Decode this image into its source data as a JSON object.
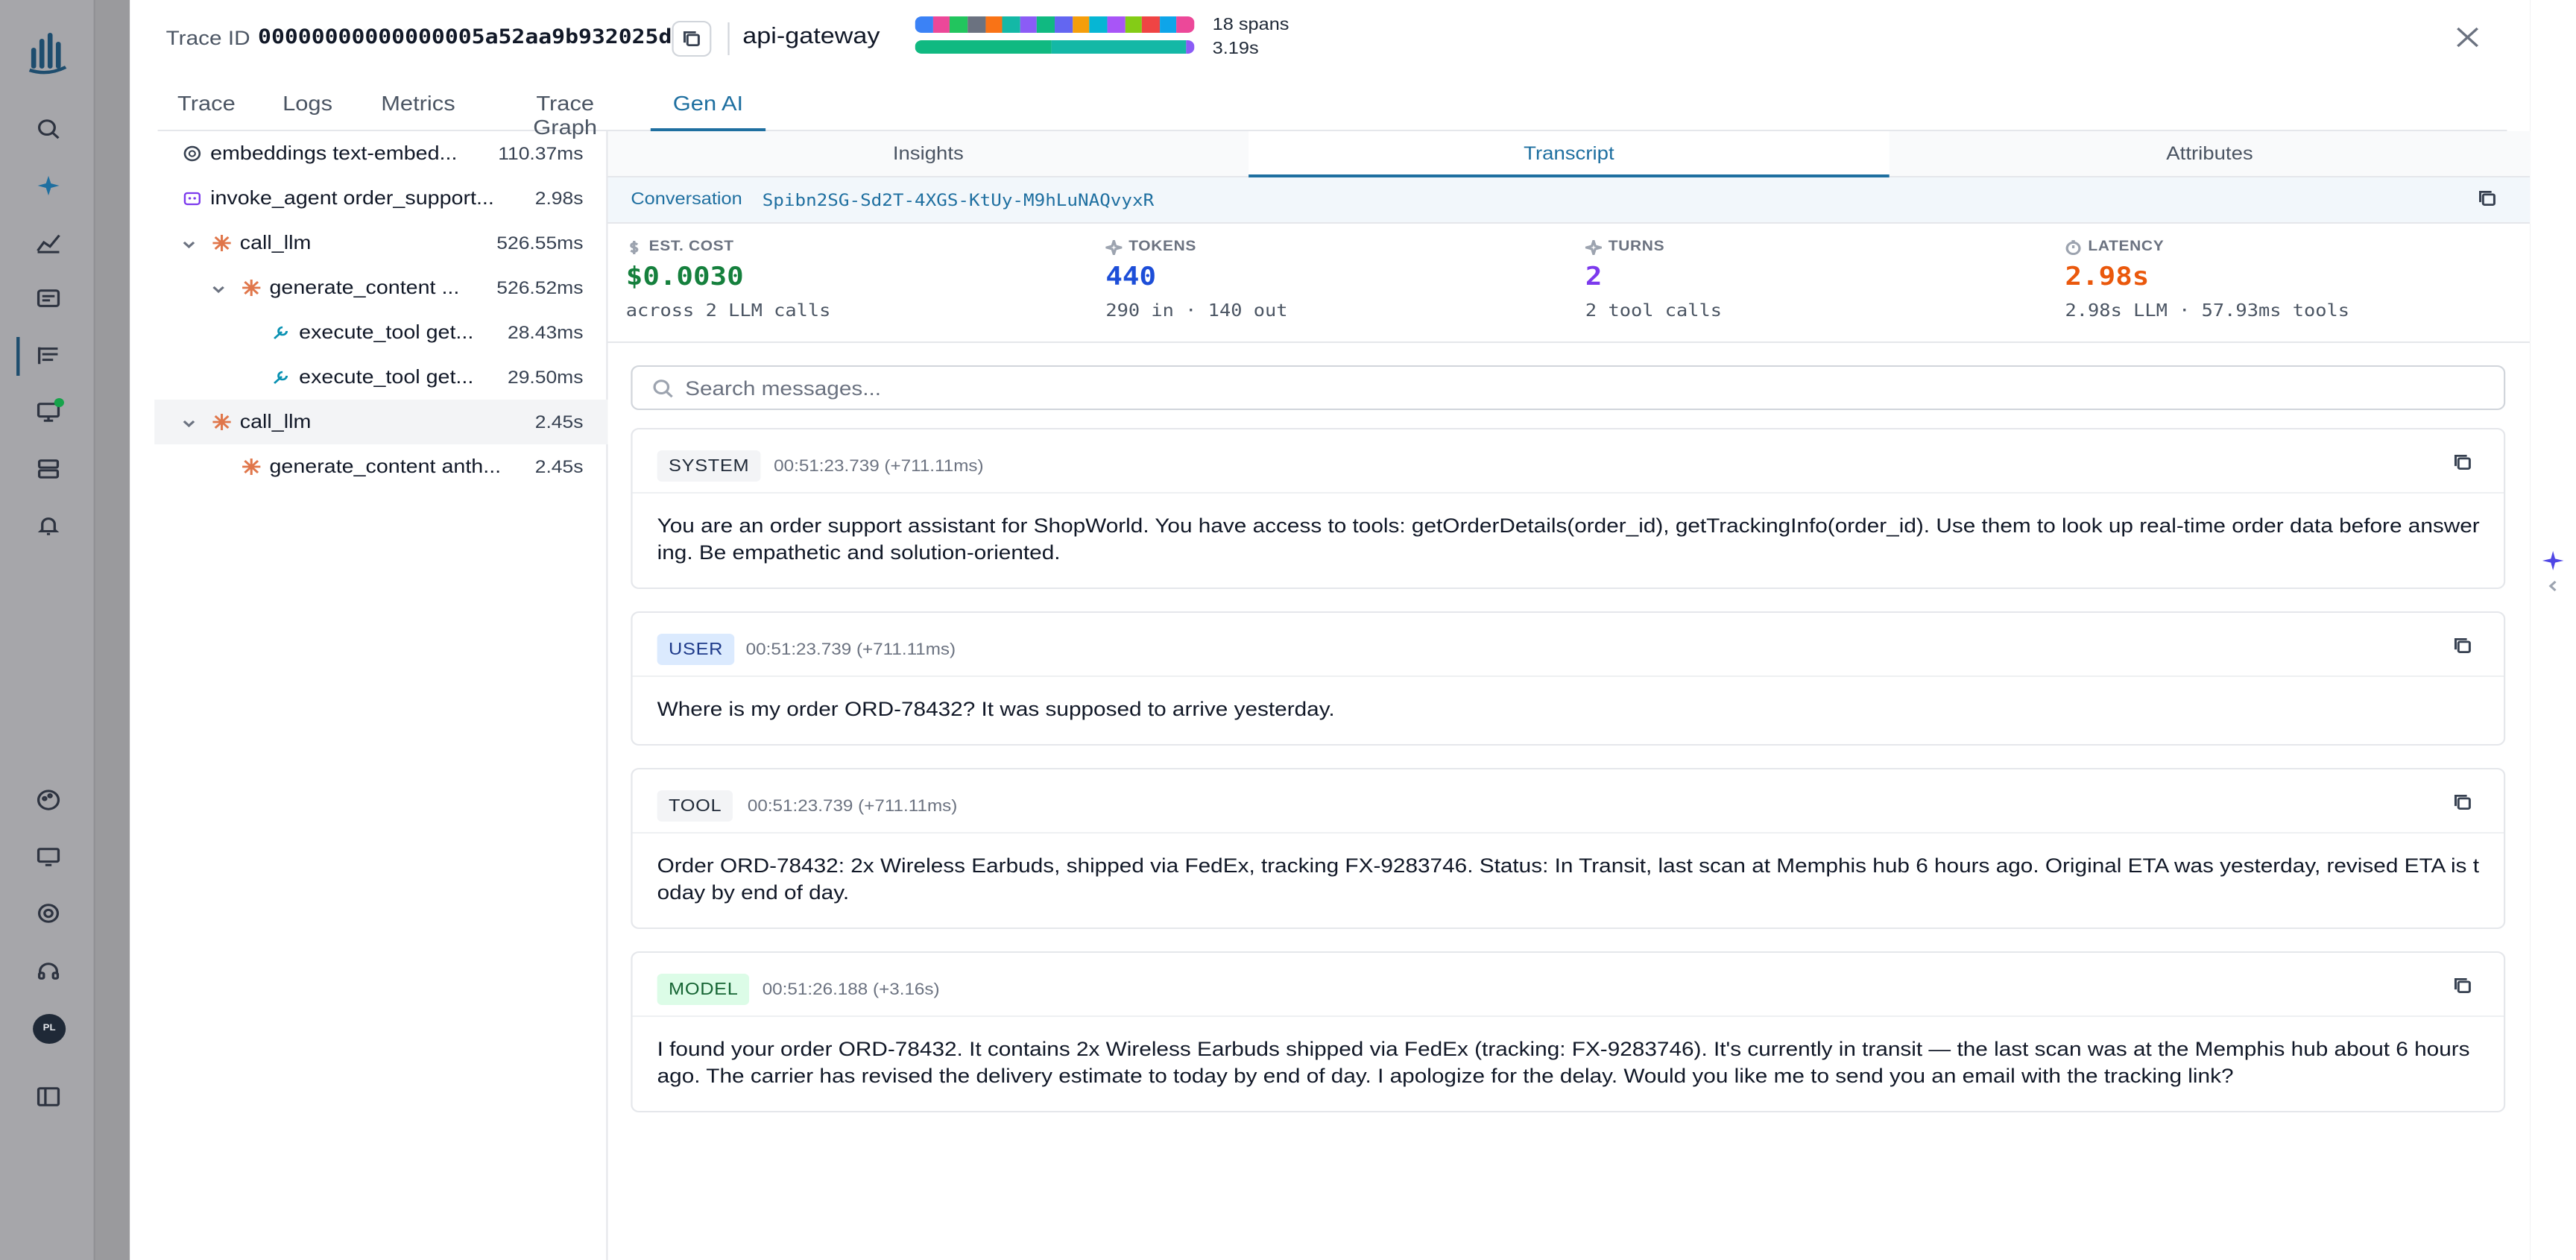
{
  "header": {
    "trace_label": "Trace ID",
    "trace_id": "00000000000000005a52aa9b932025dd",
    "service": "api-gateway",
    "spans_count": "18 spans",
    "duration": "3.19s",
    "span_colors": [
      "#3b82f6",
      "#ec4899",
      "#22c55e",
      "#6b7280",
      "#f97316",
      "#14b8a6",
      "#8b5cf6",
      "#10b981",
      "#6366f1",
      "#f59e0b",
      "#06b6d4",
      "#a855f7",
      "#84cc16",
      "#ef4444",
      "#0ea5e9",
      "#ec4899"
    ],
    "duration_colors": [
      "#10b981",
      "#14b8a6",
      "#8b5cf6"
    ]
  },
  "tabs": [
    {
      "label": "Trace"
    },
    {
      "label": "Logs"
    },
    {
      "label": "Metrics"
    },
    {
      "label": "Trace Graph"
    },
    {
      "label": "Gen AI"
    }
  ],
  "active_tab": "Gen AI",
  "tree": [
    {
      "name": "embeddings text-embed...",
      "duration": "110.37ms",
      "icon": "openai-icon"
    },
    {
      "name": "invoke_agent order_support...",
      "duration": "2.98s",
      "icon": "agent-icon"
    },
    {
      "name": "call_llm",
      "duration": "526.55ms",
      "icon": "anthropic-icon"
    },
    {
      "name": "generate_content ...",
      "duration": "526.52ms",
      "icon": "anthropic-icon"
    },
    {
      "name": "execute_tool get...",
      "duration": "28.43ms",
      "icon": "wrench-icon"
    },
    {
      "name": "execute_tool get...",
      "duration": "29.50ms",
      "icon": "wrench-icon"
    },
    {
      "name": "call_llm",
      "duration": "2.45s",
      "icon": "anthropic-icon"
    },
    {
      "name": "generate_content anth...",
      "duration": "2.45s",
      "icon": "anthropic-icon"
    }
  ],
  "subtabs": [
    {
      "label": "Insights"
    },
    {
      "label": "Transcript"
    },
    {
      "label": "Attributes"
    }
  ],
  "conversation": {
    "label": "Conversation",
    "id": "Spibn2SG-Sd2T-4XGS-KtUy-M9hLuNAQvyxR"
  },
  "stats": [
    {
      "label": "EST. COST",
      "value": "$0.0030",
      "sub": "across 2 LLM calls",
      "color": "#15803d",
      "icon": "dollar-icon"
    },
    {
      "label": "TOKENS",
      "value": "440",
      "sub": "290 in · 140 out",
      "color": "#1d4ed8",
      "icon": "sparkle-icon"
    },
    {
      "label": "TURNS",
      "value": "2",
      "sub": "2 tool calls",
      "color": "#7c3aed",
      "icon": "sparkle-icon"
    },
    {
      "label": "LATENCY",
      "value": "2.98s",
      "sub": "2.98s LLM · 57.93ms tools",
      "color": "#ea580c",
      "icon": "clock-icon"
    }
  ],
  "search": {
    "placeholder": "Search messages..."
  },
  "messages": [
    {
      "role": "SYSTEM",
      "timestamp": "00:51:23.739 (+711.11ms)",
      "content": "You are an order support assistant for ShopWorld. You have access to tools: getOrderDetails(order_id), getTrackingInfo(order_id). Use them to look up real-time order data before answering. Be empathetic and solution-oriented."
    },
    {
      "role": "USER",
      "timestamp": "00:51:23.739 (+711.11ms)",
      "content": "Where is my order ORD-78432? It was supposed to arrive yesterday."
    },
    {
      "role": "TOOL",
      "timestamp": "00:51:23.739 (+711.11ms)",
      "content": "Order ORD-78432: 2x Wireless Earbuds, shipped via FedEx, tracking FX-9283746. Status: In Transit, last scan at Memphis hub 6 hours ago. Original ETA was yesterday, revised ETA is today by end of day."
    },
    {
      "role": "MODEL",
      "timestamp": "00:51:26.188 (+3.16s)",
      "content": "I found your order ORD-78432. It contains 2x Wireless Earbuds shipped via FedEx (tracking: FX-9283746). It's currently in transit — the last scan was at the Memphis hub about 6 hours ago. The carrier has revised the delivery estimate to today by end of day. I apologize for the delay. Would you like me to send you an email with the tracking link?"
    }
  ],
  "rail": {
    "avatar_initials": "PL"
  }
}
